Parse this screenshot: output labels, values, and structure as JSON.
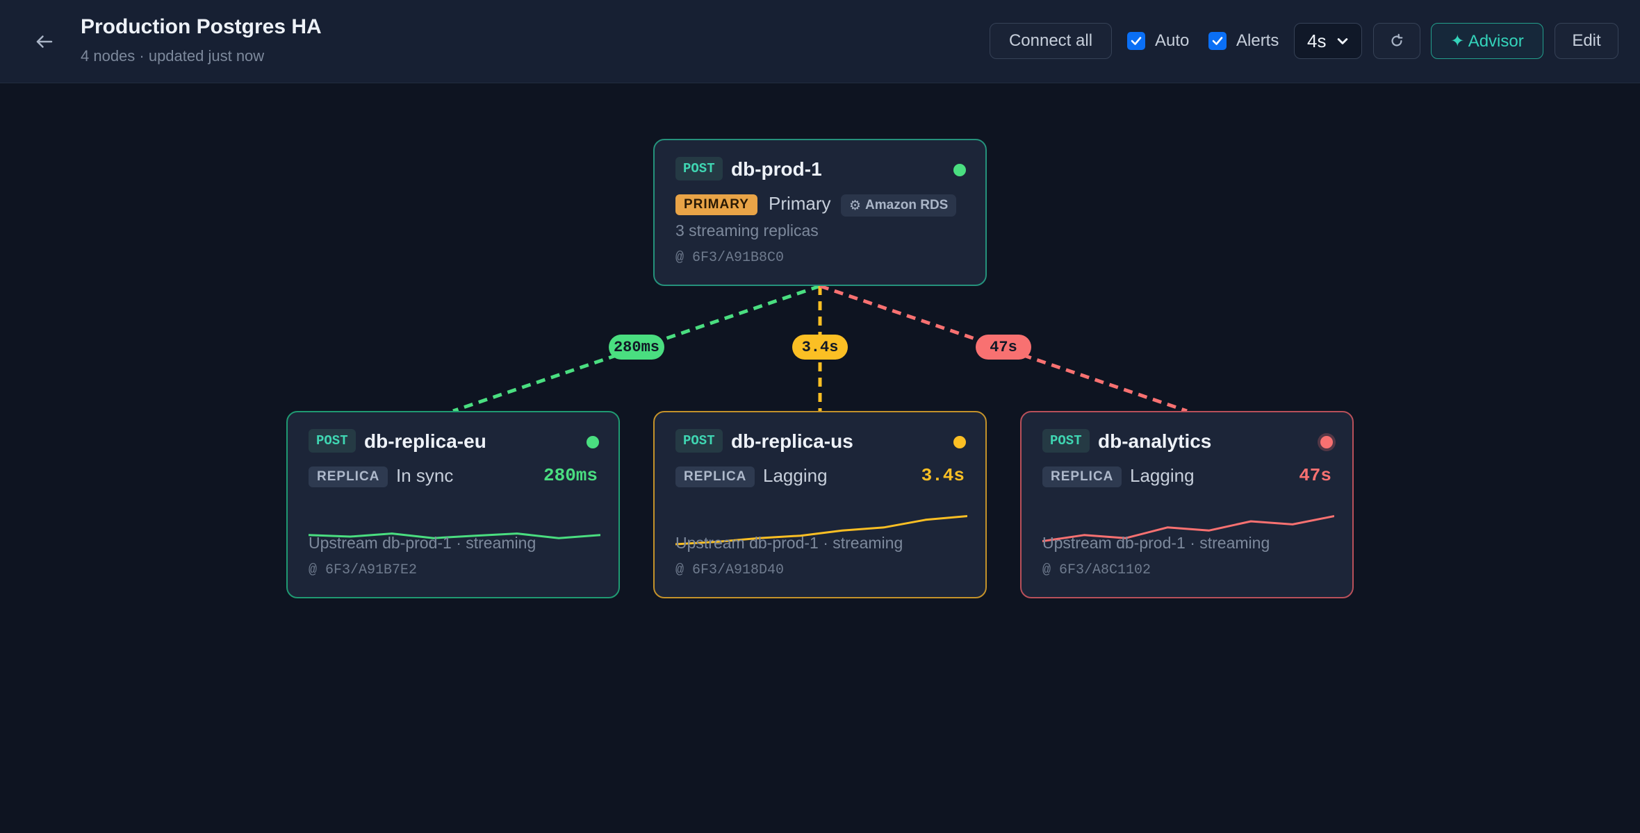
{
  "header": {
    "title": "Production Postgres HA",
    "subtitle": "4 nodes · updated just now",
    "connect_all": "Connect all",
    "auto_label": "Auto",
    "alerts_label": "Alerts",
    "interval": "4s",
    "advisor_label": "✦ Advisor",
    "edit_label": "Edit"
  },
  "colors": {
    "ok": "#4ade80",
    "warn": "#fbbf24",
    "error": "#f87171",
    "accent": "#2dd4bf"
  },
  "nodes": {
    "primary": {
      "engine": "POST",
      "name": "db-prod-1",
      "role": "PRIMARY",
      "state": "Primary",
      "provider": "Amazon RDS",
      "detail": "3 streaming replicas",
      "lsn": "@ 6F3/A91B8C0"
    },
    "eu": {
      "engine": "POST",
      "name": "db-replica-eu",
      "role": "REPLICA",
      "state": "In sync",
      "lag": "280ms",
      "detail": "Upstream db-prod-1 · streaming",
      "lsn": "@ 6F3/A91B7E2",
      "trend": [
        0.3,
        0.25,
        0.35,
        0.2,
        0.28,
        0.35,
        0.2,
        0.3
      ]
    },
    "us": {
      "engine": "POST",
      "name": "db-replica-us",
      "role": "REPLICA",
      "state": "Lagging",
      "lag": "3.4s",
      "detail": "Upstream db-prod-1 · streaming",
      "lsn": "@ 6F3/A918D40",
      "trend": [
        0.0,
        0.08,
        0.2,
        0.28,
        0.45,
        0.55,
        0.8,
        0.92
      ]
    },
    "analytics": {
      "engine": "POST",
      "name": "db-analytics",
      "role": "REPLICA",
      "state": "Lagging",
      "lag": "47s",
      "detail": "Upstream db-prod-1 · streaming",
      "lsn": "@ 6F3/A8C1102",
      "trend": [
        0.1,
        0.3,
        0.2,
        0.55,
        0.45,
        0.75,
        0.65,
        0.92
      ]
    }
  },
  "edges": [
    {
      "to": "eu",
      "label": "280ms",
      "status": "ok"
    },
    {
      "to": "us",
      "label": "3.4s",
      "status": "warn"
    },
    {
      "to": "analytics",
      "label": "47s",
      "status": "error"
    }
  ]
}
